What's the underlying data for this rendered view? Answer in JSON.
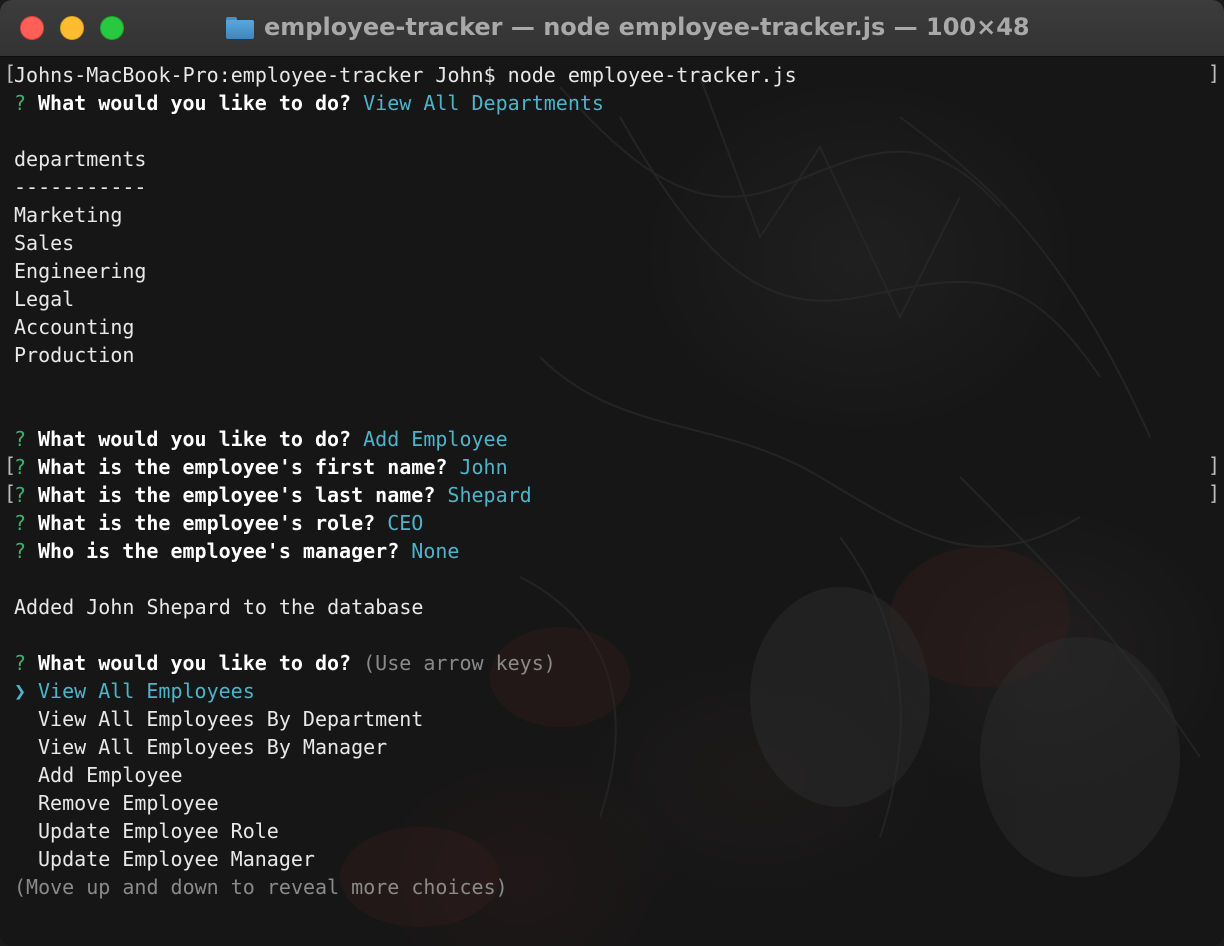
{
  "window": {
    "title": "employee-tracker — node employee-tracker.js — 100×48",
    "folder_icon": "folder-icon"
  },
  "terminal": {
    "command_line": "Johns-MacBook-Pro:employee-tracker John$ node employee-tracker.js",
    "q_mark": "?",
    "pointer": "❯",
    "bracket_left": "[",
    "bracket_right": "]",
    "prompt1": {
      "question": "What would you like to do?",
      "answer": "View All Departments"
    },
    "departments_header": "departments",
    "departments_rule": "-----------",
    "departments": [
      "Marketing",
      "Sales",
      "Engineering",
      "Legal",
      "Accounting",
      "Production"
    ],
    "prompt2": {
      "question": "What would you like to do?",
      "answer": "Add Employee"
    },
    "prompt3": {
      "question": "What is the employee's first name?",
      "answer": "John"
    },
    "prompt4": {
      "question": "What is the employee's last name?",
      "answer": "Shepard"
    },
    "prompt5": {
      "question": "What is the employee's role?",
      "answer": "CEO"
    },
    "prompt6": {
      "question": "Who is the employee's manager?",
      "answer": "None"
    },
    "added_message": "Added John Shepard to the database",
    "prompt7": {
      "question": "What would you like to do?",
      "hint": "(Use arrow keys)"
    },
    "menu": {
      "selected": "View All Employees",
      "options": [
        "View All Employees By Department",
        "View All Employees By Manager",
        "Add Employee",
        "Remove Employee",
        "Update Employee Role",
        "Update Employee Manager"
      ],
      "footer": "(Move up and down to reveal more choices)"
    }
  },
  "colors": {
    "question_mark": "#3cb371",
    "answer": "#4fb3c9",
    "hint": "#8a8a8a"
  }
}
